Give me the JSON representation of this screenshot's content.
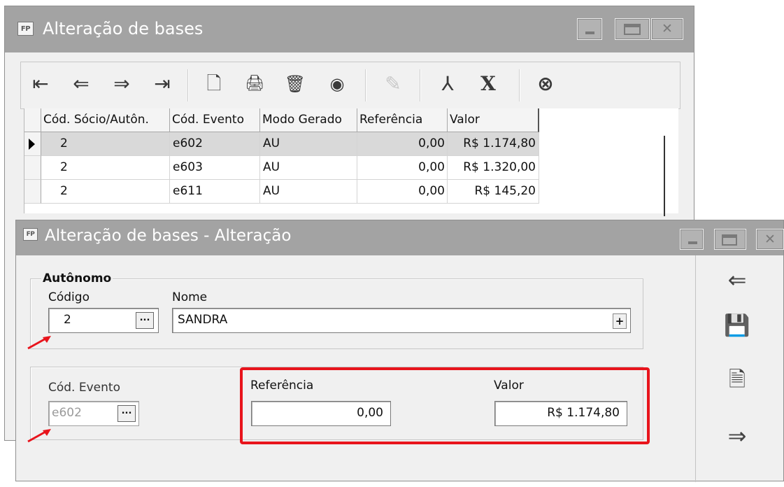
{
  "window_main": {
    "logo": "FP",
    "title": "Alteração de bases",
    "toolbar": {
      "first": "⇤",
      "prev": "⇐",
      "next": "⇒",
      "last": "⇥",
      "new": "🗋",
      "print": "🖨",
      "delete": "🗑",
      "view": "◉",
      "edit": "✎",
      "pdf": "⅄",
      "excel": "X",
      "close": "⊗"
    },
    "grid": {
      "headers": [
        "Cód. Sócio/Autôn.",
        "Cód. Evento",
        "Modo Gerado",
        "Referência",
        "Valor"
      ],
      "rows": [
        {
          "socio": "2",
          "evento": "e602",
          "modo": "AU",
          "referencia": "0,00",
          "valor": "R$ 1.174,80",
          "selected": true
        },
        {
          "socio": "2",
          "evento": "e603",
          "modo": "AU",
          "referencia": "0,00",
          "valor": "R$ 1.320,00",
          "selected": false
        },
        {
          "socio": "2",
          "evento": "e611",
          "modo": "AU",
          "referencia": "0,00",
          "valor": "R$ 145,20",
          "selected": false
        }
      ]
    }
  },
  "window_edit": {
    "logo": "FP",
    "title": "Alteração de bases - Alteração",
    "autonomo": {
      "legend": "Autônomo",
      "codigo_label": "Código",
      "codigo_value": "2",
      "nome_label": "Nome",
      "nome_value": "SANDRA"
    },
    "evento": {
      "cod_label": "Cód. Evento",
      "cod_value": "e602",
      "referencia_label": "Referência",
      "referencia_value": "0,00",
      "valor_label": "Valor",
      "valor_value": "R$ 1.174,80"
    },
    "ellipsis": "...",
    "plus": "+",
    "side_actions": {
      "back": "⇐",
      "save": "💾",
      "cancel": "🗎",
      "forward": "⇒"
    },
    "highlight_color": "#e8141c"
  }
}
